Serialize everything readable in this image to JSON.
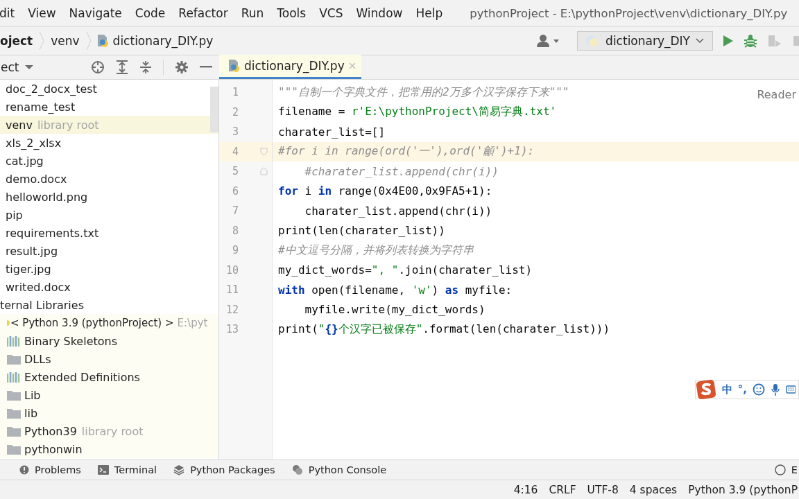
{
  "menu": [
    "dit",
    "View",
    "Navigate",
    "Code",
    "Refactor",
    "Run",
    "Tools",
    "VCS",
    "Window",
    "Help"
  ],
  "window": {
    "title": "pythonProject - E:\\pythonProject\\venv\\dictionary_DIY.py"
  },
  "breadcrumbs": [
    "oject",
    "venv",
    "dictionary_DIY.py"
  ],
  "run_config": {
    "label": "dictionary_DIY"
  },
  "project_panel": {
    "title": "ect"
  },
  "tree": [
    {
      "label": "doc_2_docx_test",
      "kind": "folder",
      "selected": false
    },
    {
      "label": "rename_test",
      "kind": "folder",
      "selected": false
    },
    {
      "label": "venv",
      "hint": "library root",
      "kind": "folder",
      "selected": true
    },
    {
      "label": "xls_2_xlsx",
      "kind": "folder",
      "selected": false
    },
    {
      "label": "cat.jpg",
      "kind": "file",
      "selected": false
    },
    {
      "label": "demo.docx",
      "kind": "file",
      "selected": false
    },
    {
      "label": "helloworld.png",
      "kind": "file",
      "selected": false
    },
    {
      "label": "pip",
      "kind": "file",
      "selected": false
    },
    {
      "label": "requirements.txt",
      "kind": "file",
      "selected": false
    },
    {
      "label": "result.jpg",
      "kind": "file",
      "selected": false
    },
    {
      "label": "tiger.jpg",
      "kind": "file",
      "selected": false
    },
    {
      "label": "writed.docx",
      "kind": "file",
      "selected": false
    },
    {
      "label": "ternal Libraries",
      "kind": "group",
      "selected": false,
      "children": [
        {
          "label": "< Python 3.9 (pythonProject) >",
          "hint": "E:\\pyt",
          "kind": "sdk",
          "selected": false,
          "children": [
            {
              "label": "Binary Skeletons",
              "kind": "library",
              "selected": false
            },
            {
              "label": "DLLs",
              "kind": "folder",
              "selected": false
            },
            {
              "label": "Extended Definitions",
              "kind": "library",
              "selected": false
            },
            {
              "label": "Lib",
              "kind": "folder",
              "selected": false
            },
            {
              "label": "lib",
              "kind": "folder",
              "selected": false
            },
            {
              "label": "Python39",
              "hint": "library root",
              "kind": "folder",
              "selected": false
            },
            {
              "label": "pythonwin",
              "kind": "folder",
              "selected": false
            }
          ]
        }
      ]
    }
  ],
  "editor_tabs": [
    {
      "label": "dictionary_DIY.py",
      "selected": true
    }
  ],
  "reader_mode": "Reader",
  "code": [
    {
      "number": "1",
      "current": false,
      "tokens": [
        {
          "text": "\"\"\"自制一个字典文件，把常用的2万多个汉字保存下来\"\"\"",
          "kind": "doc"
        }
      ]
    },
    {
      "number": "2",
      "current": false,
      "tokens": [
        {
          "text": "filename = ",
          "kind": "plain"
        },
        {
          "text": "r'E:\\pythonProject\\简易字典.txt'",
          "kind": "string"
        }
      ]
    },
    {
      "number": "3",
      "current": false,
      "tokens": [
        {
          "text": "charater_list=[]",
          "kind": "plain"
        }
      ]
    },
    {
      "number": "4",
      "current": true,
      "kind": "foldstart",
      "tokens": [
        {
          "text": "#for i in range(ord('一'),ord('龥')+1):",
          "kind": "comment"
        }
      ]
    },
    {
      "number": "5",
      "current": false,
      "kind": "foldend",
      "tokens": [
        {
          "text": "    #charater_list.append(chr(i))",
          "kind": "comment"
        }
      ]
    },
    {
      "number": "6",
      "current": false,
      "tokens": [
        {
          "text": "for",
          "kind": "keyword"
        },
        {
          "text": " i ",
          "kind": "plain"
        },
        {
          "text": "in",
          "kind": "keyword"
        },
        {
          "text": " range(0x4E00,0x9FA5+1):",
          "kind": "plain"
        }
      ]
    },
    {
      "number": "7",
      "current": false,
      "tokens": [
        {
          "text": "    charater_list.append(chr(i))",
          "kind": "plain"
        }
      ]
    },
    {
      "number": "8",
      "current": false,
      "tokens": [
        {
          "text": "print(len(charater_list))",
          "kind": "plain"
        }
      ]
    },
    {
      "number": "9",
      "current": false,
      "tokens": [
        {
          "text": "#中文逗号分隔，并将列表转换为字符串",
          "kind": "comment"
        }
      ]
    },
    {
      "number": "10",
      "current": false,
      "tokens": [
        {
          "text": "my_dict_words=",
          "kind": "plain"
        },
        {
          "text": "\", \"",
          "kind": "string"
        },
        {
          "text": ".join(charater_list)",
          "kind": "plain"
        }
      ]
    },
    {
      "number": "11",
      "current": false,
      "tokens": [
        {
          "text": "with",
          "kind": "keyword"
        },
        {
          "text": " open(filename, ",
          "kind": "plain"
        },
        {
          "text": "'w'",
          "kind": "string"
        },
        {
          "text": ") ",
          "kind": "plain"
        },
        {
          "text": "as",
          "kind": "keyword"
        },
        {
          "text": " myfile:",
          "kind": "plain"
        }
      ]
    },
    {
      "number": "12",
      "current": false,
      "tokens": [
        {
          "text": "    myfile.write(my_dict_words)",
          "kind": "plain"
        }
      ]
    },
    {
      "number": "13",
      "current": false,
      "tokens": [
        {
          "text": "print(",
          "kind": "plain"
        },
        {
          "text": "\"",
          "kind": "string"
        },
        {
          "text": "{}",
          "kind": "format"
        },
        {
          "text": "个汉字已被保存\"",
          "kind": "string"
        },
        {
          "text": ".format(len(charater_list)))",
          "kind": "plain"
        }
      ]
    }
  ],
  "ime": {
    "mode": "中",
    "punctuation": "°,"
  },
  "tool_windows": [
    {
      "label": "Problems",
      "kind": "problems"
    },
    {
      "label": "Terminal",
      "kind": "terminal"
    },
    {
      "label": "Python Packages",
      "kind": "packages"
    },
    {
      "label": "Python Console",
      "kind": "console"
    }
  ],
  "event_log": "E",
  "status_bar": [
    "4:16",
    "CRLF",
    "UTF-8",
    "4 spaces",
    "Python 3.9 (pythonP"
  ]
}
